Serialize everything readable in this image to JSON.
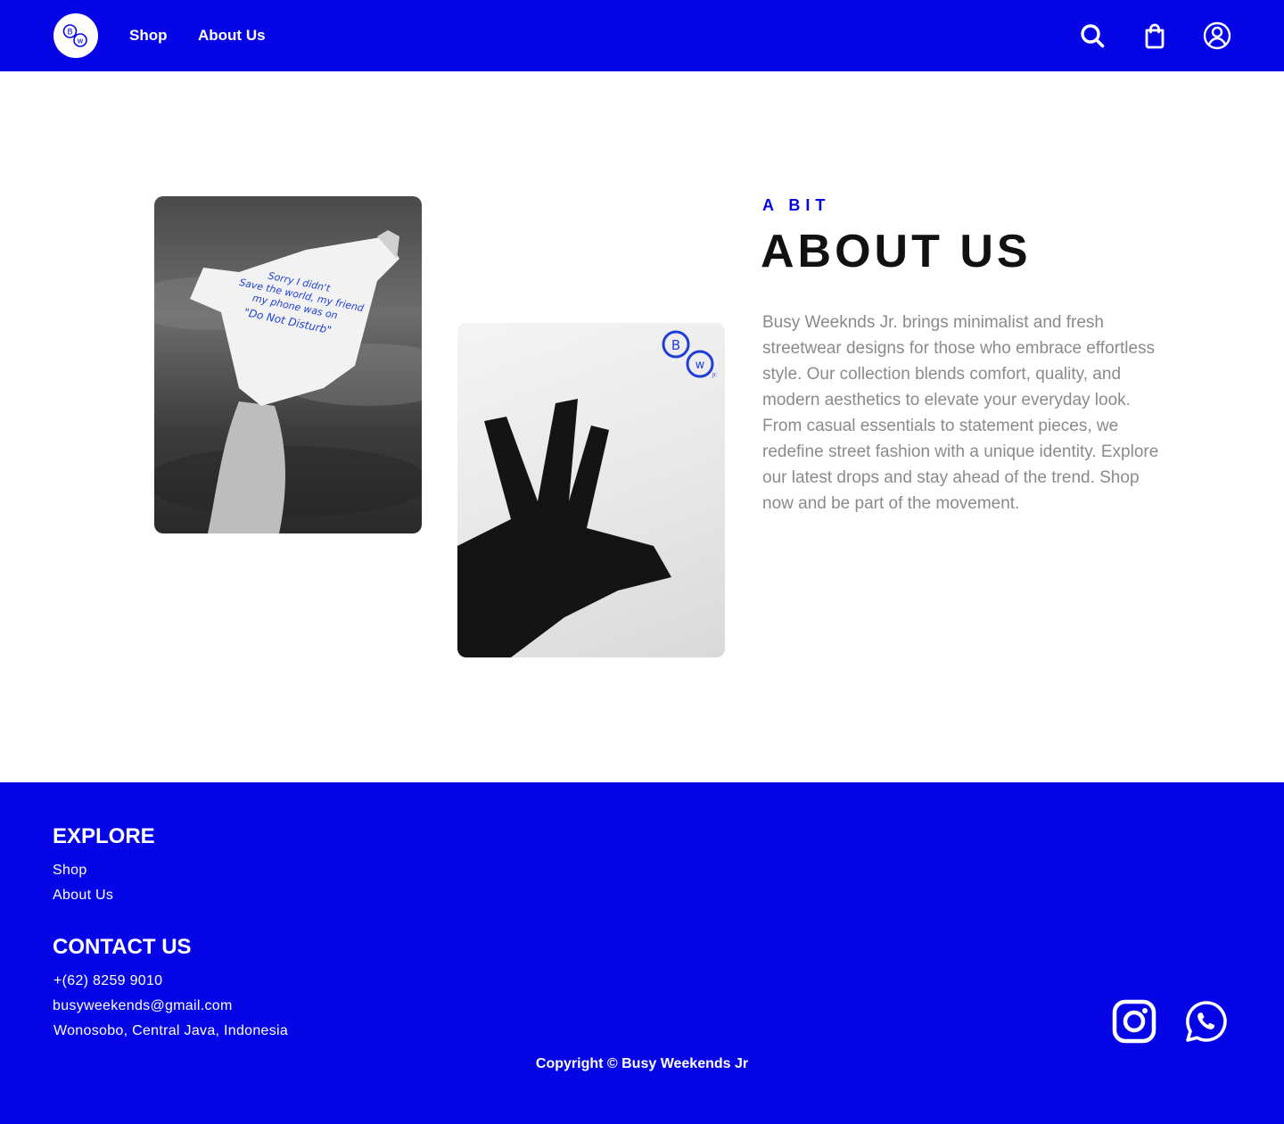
{
  "brand": {
    "logo_mark": "BW",
    "color_primary": "#0505e6"
  },
  "nav": {
    "links": [
      {
        "label": "Shop"
      },
      {
        "label": "About Us"
      }
    ],
    "icons": [
      "search-icon",
      "shopping-bag-icon",
      "user-account-icon"
    ]
  },
  "about": {
    "eyebrow": "A BIT",
    "title": "ABOUT US",
    "body": "Busy Weeknds Jr. brings minimalist and fresh streetwear designs for those who embrace effortless style. Our collection blends comfort, quality, and modern aesthetics to elevate your everyday look. From casual essentials to statement pieces, we redefine street fashion with a unique identity. Explore our latest drops and stay ahead of the trend. Shop now and be part of the movement.",
    "photo_shirt_text": "Sorry I didn't Save the world, my friend my phone was on \"Do Not Disturb\"",
    "photo_hand_mark": "BW Jr."
  },
  "footer": {
    "explore_heading": "EXPLORE",
    "explore_links": [
      {
        "label": "Shop"
      },
      {
        "label": "About Us"
      }
    ],
    "contact_heading": "CONTACT US",
    "phone": "+(62) 8259 9010",
    "email": "busyweekends@gmail.com",
    "address": "Wonosobo, Central Java, Indonesia",
    "social": [
      "instagram-icon",
      "whatsapp-icon"
    ],
    "copyright": "Copyright © Busy Weekends Jr"
  }
}
